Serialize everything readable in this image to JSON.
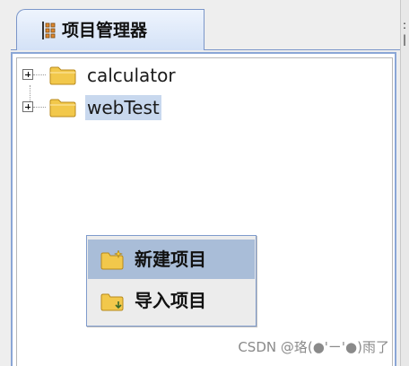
{
  "panel": {
    "tab_label": "项目管理器"
  },
  "tree": {
    "nodes": [
      {
        "label": "calculator",
        "selected": false
      },
      {
        "label": "webTest",
        "selected": true
      }
    ]
  },
  "context_menu": {
    "items": [
      {
        "label": "新建项目",
        "icon": "new-project-folder-icon",
        "highlighted": true
      },
      {
        "label": "导入项目",
        "icon": "import-project-folder-icon",
        "highlighted": false
      }
    ]
  },
  "watermark": "CSDN @珞(●'ㄧ'●)雨了",
  "colors": {
    "selection": "#c8d8ee",
    "menu_highlight": "#a9bdd8",
    "tab_border": "#7b96c9",
    "folder": "#f2c84b"
  }
}
